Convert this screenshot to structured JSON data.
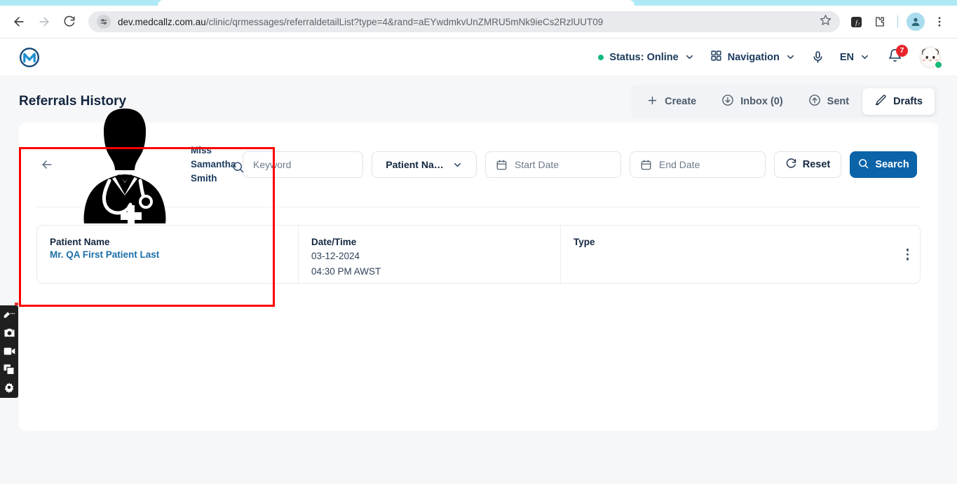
{
  "browser": {
    "back_icon": "back-arrow-icon",
    "forward_icon": "forward-arrow-icon",
    "reload_icon": "reload-icon",
    "site_info_icon": "site-settings-icon",
    "url_domain": "dev.medcallz.com.au",
    "url_path": "/clinic/qrmessages/referraldetailList?type=4&rand=aEYwdmkvUnZMRU5mNk9ieCs2RzlUUT09",
    "bookmark_icon": "star-icon",
    "ext_math_icon": "math-extension-icon",
    "ext_puzzle_icon": "extensions-puzzle-icon",
    "profile_icon": "profile-avatar-icon",
    "menu_icon": "three-dot-menu-icon"
  },
  "header": {
    "logo_name": "medcallz-logo",
    "status_label": "Status: Online",
    "status_color": "#10b981",
    "navigation_label": "Navigation",
    "mic_icon": "microphone-icon",
    "language_label": "EN",
    "notification_count": "7",
    "notification_icon": "bell-icon",
    "avatar_name": "user-avatar",
    "online_indicator_color": "#17b978"
  },
  "page": {
    "title": "Referrals History",
    "tabs": [
      {
        "label": "Create",
        "icon": "plus-icon",
        "active": false
      },
      {
        "label": "Inbox (0)",
        "icon": "inbox-download-icon",
        "active": false
      },
      {
        "label": "Sent",
        "icon": "sent-upload-icon",
        "active": false
      },
      {
        "label": "Drafts",
        "icon": "pencil-edit-icon",
        "active": true
      }
    ]
  },
  "filters": {
    "back_icon": "back-arrow-icon",
    "person_photo_name": "doctor-silhouette-photo",
    "person_name": "Miss Samantha Smith",
    "person_search_icon": "magnifier-icon",
    "keyword_placeholder": "Keyword",
    "select_value": "Patient Na…",
    "select_chevron": "chevron-down-icon",
    "start_date_placeholder": "Start Date",
    "end_date_placeholder": "End Date",
    "calendar_icon": "calendar-icon",
    "reset_label": "Reset",
    "reset_icon": "refresh-icon",
    "search_label": "Search",
    "search_icon": "magnifier-icon",
    "search_button_color": "#0b63a8"
  },
  "record": {
    "patient_name_label": "Patient Name",
    "patient_name_value": "Mr. QA First Patient Last",
    "datetime_label": "Date/Time",
    "datetime_date": "03-12-2024",
    "datetime_time": "04:30 PM AWST",
    "type_label": "Type",
    "type_value": "",
    "menu_icon": "kebab-menu-icon"
  },
  "annotation": {
    "name": "red-highlight-box",
    "color": "#fc0000"
  },
  "recorder_toolbar": {
    "items": [
      {
        "icon": "pen-annotate-icon"
      },
      {
        "icon": "camera-screenshot-icon"
      },
      {
        "icon": "video-record-icon"
      },
      {
        "icon": "window-capture-icon"
      },
      {
        "icon": "settings-gear-icon"
      }
    ]
  }
}
